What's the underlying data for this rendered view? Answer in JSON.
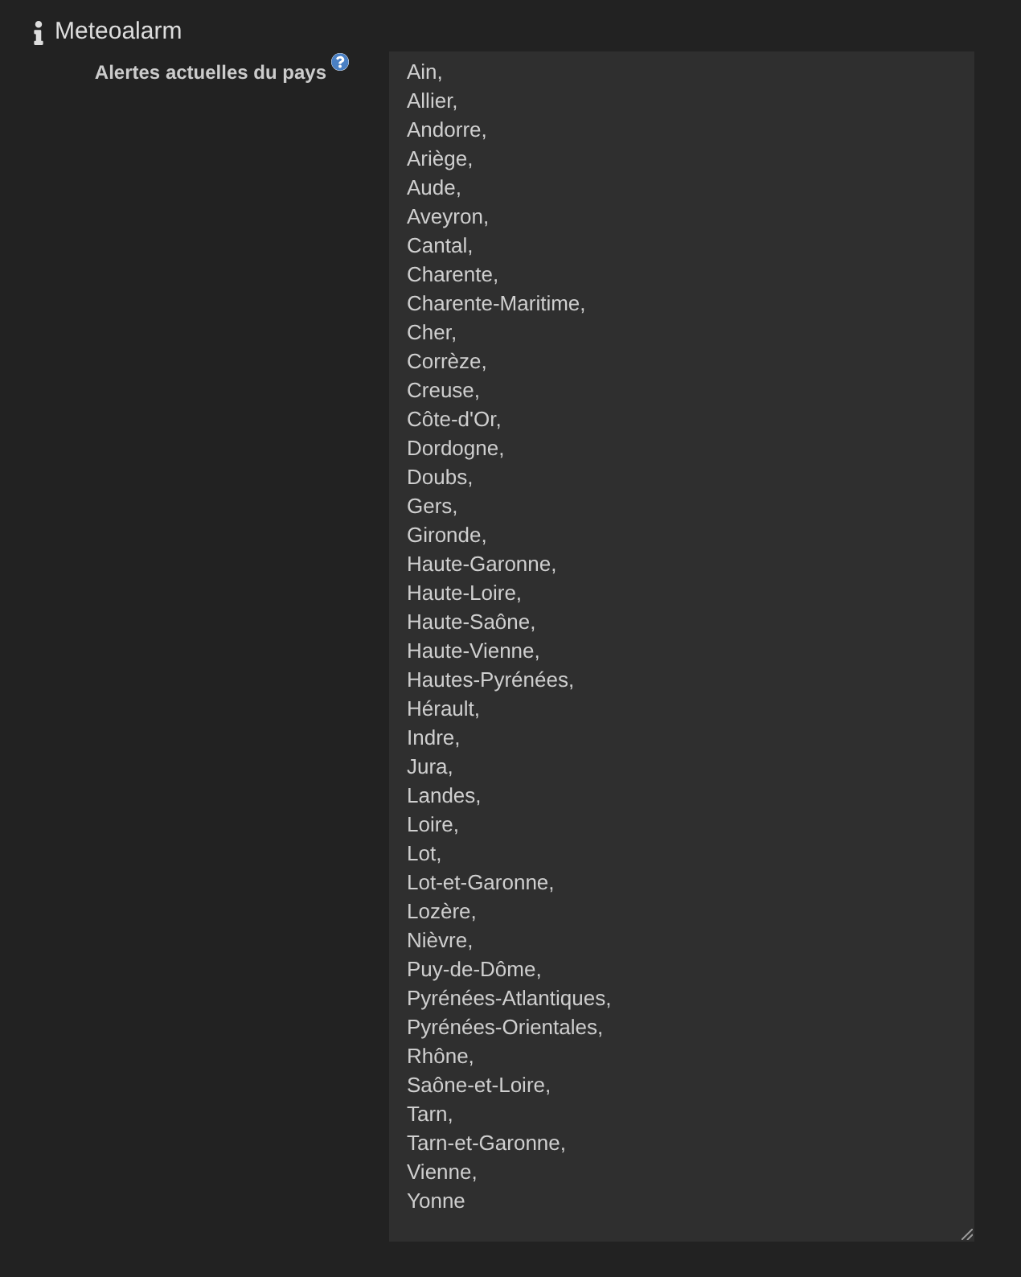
{
  "section": {
    "title": "Meteoalarm"
  },
  "field": {
    "label": "Alertes actuelles du pays",
    "value": "Ain,\nAllier,\nAndorre,\nAriège,\nAude,\nAveyron,\nCantal,\nCharente,\nCharente-Maritime,\nCher,\nCorrèze,\nCreuse,\nCôte-d'Or,\nDordogne,\nDoubs,\nGers,\nGironde,\nHaute-Garonne,\nHaute-Loire,\nHaute-Saône,\nHaute-Vienne,\nHautes-Pyrénées,\nHérault,\nIndre,\nJura,\nLandes,\nLoire,\nLot,\nLot-et-Garonne,\nLozère,\nNièvre,\nPuy-de-Dôme,\nPyrénées-Atlantiques,\nPyrénées-Orientales,\nRhône,\nSaône-et-Loire,\nTarn,\nTarn-et-Garonne,\nVienne,\nYonne"
  }
}
